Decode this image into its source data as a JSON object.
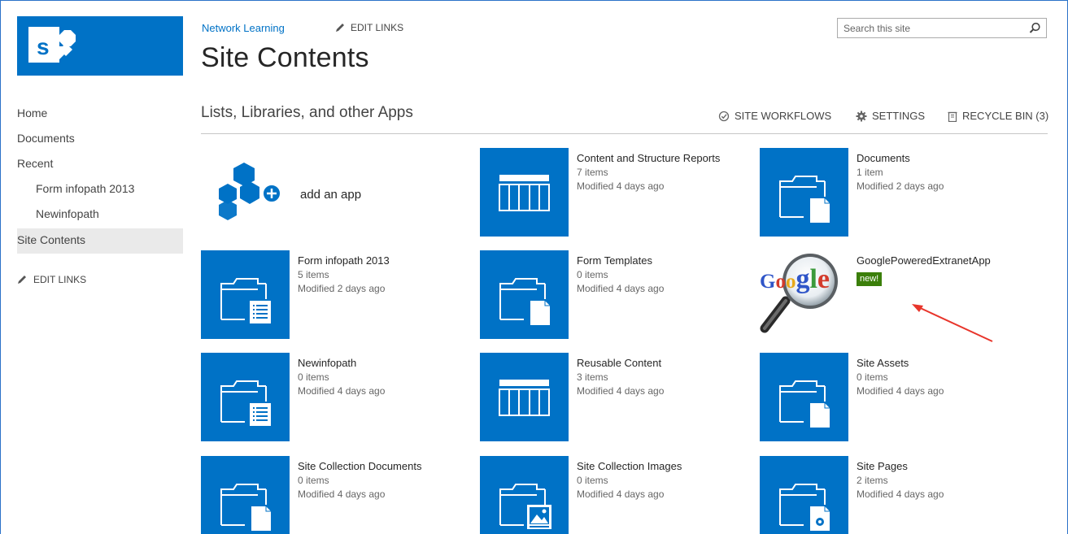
{
  "colors": {
    "brand": "#0072c6",
    "new_badge": "#3b7f0a",
    "arrow": "#e8352b"
  },
  "header": {
    "site_link": "Network Learning",
    "edit_links": "EDIT LINKS",
    "page_title": "Site Contents",
    "search_placeholder": "Search this site"
  },
  "nav": {
    "items": [
      {
        "label": "Home"
      },
      {
        "label": "Documents"
      },
      {
        "label": "Recent"
      },
      {
        "label": "Form infopath 2013"
      },
      {
        "label": "Newinfopath"
      },
      {
        "label": "Site Contents"
      }
    ],
    "edit_links": "EDIT LINKS"
  },
  "section": {
    "title": "Lists, Libraries, and other Apps",
    "site_workflows": "SITE WORKFLOWS",
    "settings": "SETTINGS",
    "recycle_bin": "RECYCLE BIN (3)"
  },
  "add_app": {
    "label": "add an app",
    "icon": "add-app-icon"
  },
  "tiles": [
    {
      "name": "Content and Structure Reports",
      "items": "7 items",
      "modified": "Modified 4 days ago",
      "icon": "list-icon"
    },
    {
      "name": "Documents",
      "items": "1 item",
      "modified": "Modified 2 days ago",
      "icon": "document-library-icon"
    },
    {
      "name": "Form infopath 2013",
      "items": "5 items",
      "modified": "Modified 2 days ago",
      "icon": "form-library-icon"
    },
    {
      "name": "Form Templates",
      "items": "0 items",
      "modified": "Modified 4 days ago",
      "icon": "document-library-icon"
    },
    {
      "name": "GooglePoweredExtranetApp",
      "badge": "new!",
      "icon": "google-app-icon",
      "logo_text": "Google"
    },
    {
      "name": "Newinfopath",
      "items": "0 items",
      "modified": "Modified 4 days ago",
      "icon": "form-library-icon"
    },
    {
      "name": "Reusable Content",
      "items": "3 items",
      "modified": "Modified 4 days ago",
      "icon": "list-icon"
    },
    {
      "name": "Site Assets",
      "items": "0 items",
      "modified": "Modified 4 days ago",
      "icon": "document-library-icon"
    },
    {
      "name": "Site Collection Documents",
      "items": "0 items",
      "modified": "Modified 4 days ago",
      "icon": "document-library-icon"
    },
    {
      "name": "Site Collection Images",
      "items": "0 items",
      "modified": "Modified 4 days ago",
      "icon": "picture-library-icon"
    },
    {
      "name": "Site Pages",
      "items": "2 items",
      "modified": "Modified 4 days ago",
      "icon": "wiki-library-icon"
    }
  ]
}
